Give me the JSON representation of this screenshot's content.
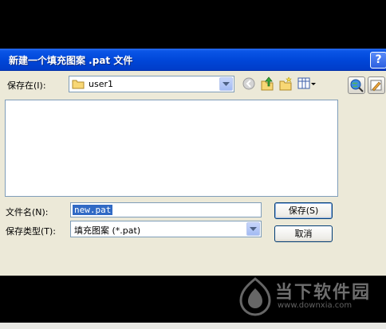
{
  "window": {
    "title": "新建一个填充图案 .pat 文件",
    "help_label": "?"
  },
  "location": {
    "label": "保存在(I):",
    "value": "user1"
  },
  "toolbar": {
    "icons": [
      "back-icon",
      "up-folder-icon",
      "new-folder-icon",
      "view-menu-icon"
    ]
  },
  "file_list": {
    "items": []
  },
  "filename": {
    "label": "文件名(N):",
    "value": "new.pat"
  },
  "filetype": {
    "label": "保存类型(T):",
    "value": "填充图案 (*.pat)"
  },
  "buttons": {
    "save": "保存(S)",
    "cancel": "取消"
  },
  "watermark": {
    "name": "当下软件园",
    "url": "www.downxia.com"
  },
  "colors": {
    "titlebar": "#0046d8",
    "dialog_bg": "#ece9d8",
    "selection": "#316ac5"
  }
}
